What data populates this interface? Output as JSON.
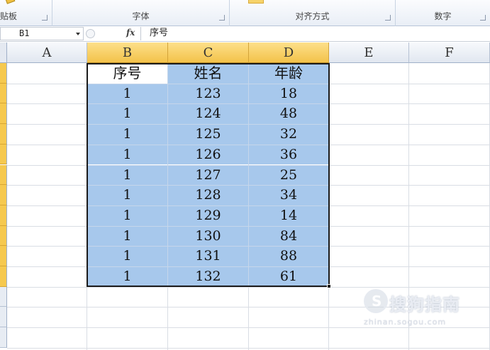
{
  "ribbon": {
    "groups": [
      {
        "label": "贴板"
      },
      {
        "label": "字体"
      },
      {
        "label": "对齐方式"
      },
      {
        "label": "数字"
      }
    ]
  },
  "formula_bar": {
    "name_box": "B1",
    "fx_label": "fx",
    "content": "序号"
  },
  "columns": [
    "A",
    "B",
    "C",
    "D",
    "E",
    "F"
  ],
  "selected_columns": [
    "B",
    "C",
    "D"
  ],
  "table": {
    "headers": [
      "序号",
      "姓名",
      "年龄"
    ],
    "rows": [
      [
        "1",
        "123",
        "18"
      ],
      [
        "1",
        "124",
        "48"
      ],
      [
        "1",
        "125",
        "32"
      ],
      [
        "1",
        "126",
        "36"
      ],
      [
        "1",
        "127",
        "25"
      ],
      [
        "1",
        "128",
        "34"
      ],
      [
        "1",
        "129",
        "14"
      ],
      [
        "1",
        "130",
        "84"
      ],
      [
        "1",
        "131",
        "88"
      ],
      [
        "1",
        "132",
        "61"
      ]
    ]
  },
  "watermark": {
    "logo_char": "S",
    "text": "搜狗指南",
    "url": "zhinan.sogou.com"
  },
  "colors": {
    "selection_fill": "#a7c8ec",
    "selected_header": "#f3c24a",
    "border": "#1b1b1b"
  }
}
